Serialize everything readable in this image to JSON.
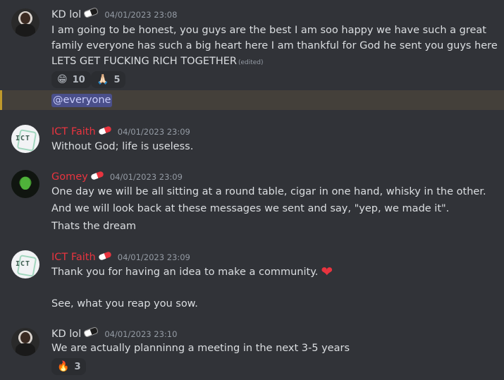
{
  "messages": [
    {
      "author": "KD lol",
      "timestamp": "04/01/2023 23:08",
      "lines": [
        "I am going to be honest, you guys are the best I am soo happy we have such a great",
        "family everyone has such a big heart here I am thankful for God he sent you guys here",
        "LETS GET FUCKING RICH TOGETHER"
      ],
      "edited_label": "(edited)",
      "reactions": [
        {
          "emoji": "😁",
          "icon": "grinning-face-icon",
          "count": "10"
        },
        {
          "emoji": "🙏🏻",
          "icon": "folded-hands-icon",
          "count": "5"
        }
      ],
      "mention": "@everyone"
    },
    {
      "author": "ICT Faith",
      "timestamp": "04/01/2023 23:09",
      "lines": [
        "Without God; life is useless."
      ]
    },
    {
      "author": "Gomey",
      "timestamp": "04/01/2023 23:09",
      "lines": [
        "One day we will be all sitting at a round table, cigar in one hand, whisky in the other.",
        "And we will look back at these messages we sent and say, \"yep, we made it\".",
        "Thats the dream"
      ]
    },
    {
      "author": "ICT Faith",
      "timestamp": "04/01/2023 23:09",
      "lines": [
        "Thank you for having an idea to make a community.",
        "See, what you reap you sow."
      ],
      "heart": "❤"
    },
    {
      "author": "KD lol",
      "timestamp": "04/01/2023 23:10",
      "lines": [
        "We are actually planninng a meeting in the next 3-5 years"
      ],
      "reactions": [
        {
          "emoji": "🔥",
          "icon": "fire-icon",
          "count": "3"
        }
      ]
    }
  ],
  "colors": {
    "background": "#313338",
    "role_red": "#e8343f",
    "mention_highlight": "#44403a",
    "mention_bar": "#c09a2b"
  }
}
